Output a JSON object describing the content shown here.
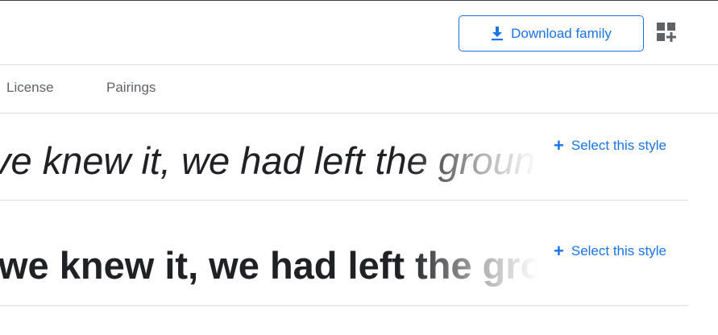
{
  "header": {
    "download_label": "Download family",
    "download_icon": "download-icon",
    "apps_icon": "apps-add-icon"
  },
  "tabs": [
    {
      "label": "License"
    },
    {
      "label": "Pairings"
    }
  ],
  "styles": [
    {
      "sample": "ve knew it, we had left the ground.",
      "style": "italic",
      "select_label": "Select this style"
    },
    {
      "sample": "we knew it, we had left the groun",
      "style": "bold",
      "select_label": "Select this style"
    }
  ],
  "colors": {
    "accent": "#1a73e8",
    "text": "#202124",
    "muted": "#5f6368",
    "divider": "#dadce0"
  }
}
